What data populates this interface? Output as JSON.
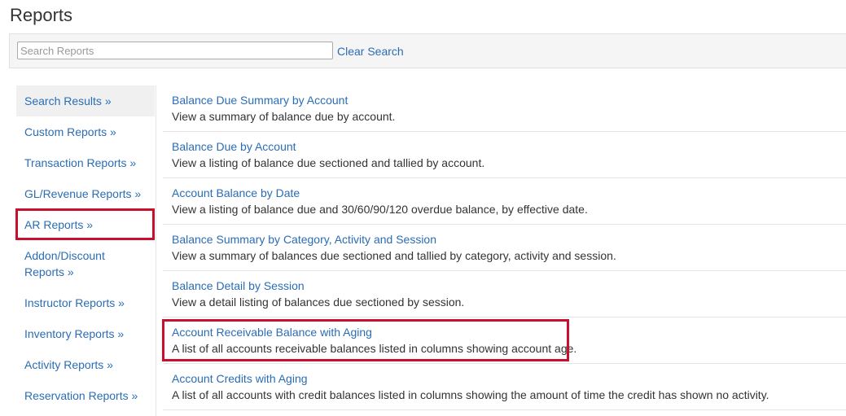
{
  "page": {
    "title": "Reports"
  },
  "search": {
    "placeholder": "Search Reports",
    "value": "",
    "clear_label": "Clear Search"
  },
  "sidebar": {
    "items": [
      {
        "label": "Search Results »"
      },
      {
        "label": "Custom Reports »"
      },
      {
        "label": "Transaction Reports »"
      },
      {
        "label": "GL/Revenue Reports »"
      },
      {
        "label": "AR Reports »"
      },
      {
        "label": "Addon/Discount Reports »"
      },
      {
        "label": "Instructor Reports »"
      },
      {
        "label": "Inventory Reports »"
      },
      {
        "label": "Activity Reports »"
      },
      {
        "label": "Reservation Reports »"
      }
    ]
  },
  "reports": [
    {
      "title": "Balance Due Summary by Account",
      "description": "View a summary of balance due by account."
    },
    {
      "title": "Balance Due by Account",
      "description": "View a listing of balance due sectioned and tallied by account."
    },
    {
      "title": "Account Balance by Date",
      "description": "View a listing of balance due and 30/60/90/120 overdue balance, by effective date."
    },
    {
      "title": "Balance Summary by Category, Activity and Session",
      "description": "View a summary of balances due sectioned and tallied by category, activity and session."
    },
    {
      "title": "Balance Detail by Session",
      "description": "View a detail listing of balances due sectioned by session."
    },
    {
      "title": "Account Receivable Balance with Aging",
      "description": "A list of all accounts receivable balances listed in columns showing account age."
    },
    {
      "title": "Account Credits with Aging",
      "description": "A list of all accounts with credit balances listed in columns showing the amount of time the credit has shown no activity."
    }
  ],
  "colors": {
    "link": "#2a6db5",
    "text": "#333333",
    "highlight": "#c8102e",
    "search_bar_bg": "#f5f5f5",
    "active_item_bg": "#f0f0f0"
  }
}
